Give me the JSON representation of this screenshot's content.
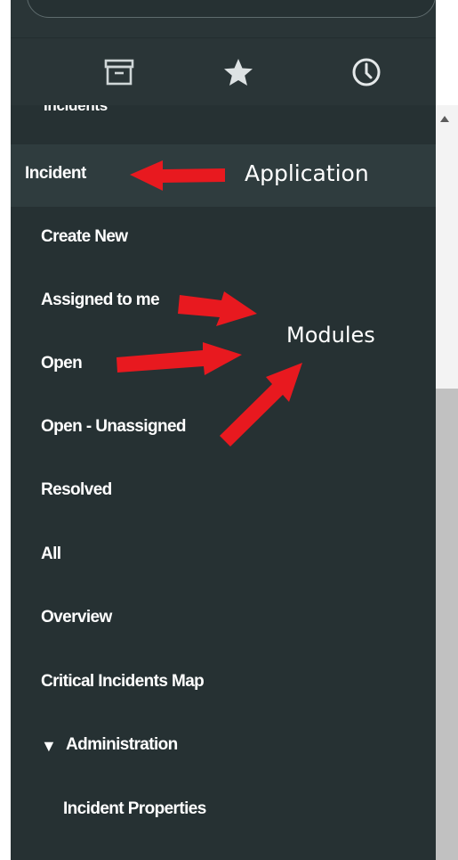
{
  "tabs": [
    {
      "id": "archive",
      "icon": "archive-icon"
    },
    {
      "id": "favorites",
      "icon": "star-icon"
    },
    {
      "id": "history",
      "icon": "clock-icon"
    }
  ],
  "nav": {
    "section_heading": "Incidents",
    "application": "Incident",
    "modules": [
      {
        "label": "Create New"
      },
      {
        "label": "Assigned to me"
      },
      {
        "label": "Open"
      },
      {
        "label": "Open - Unassigned"
      },
      {
        "label": "Resolved"
      },
      {
        "label": "All"
      },
      {
        "label": "Overview"
      },
      {
        "label": "Critical Incidents Map"
      }
    ],
    "admin_section": {
      "caret": "▼",
      "label": "Administration",
      "items": [
        {
          "label": "Incident Properties"
        }
      ]
    }
  },
  "annotations": {
    "application_label": "Application",
    "modules_label": "Modules",
    "arrow_color": "#e8191f"
  },
  "colors": {
    "panel_bg": "#263133",
    "selected_row_bg": "#2f3c3e",
    "text": "#ffffff"
  }
}
